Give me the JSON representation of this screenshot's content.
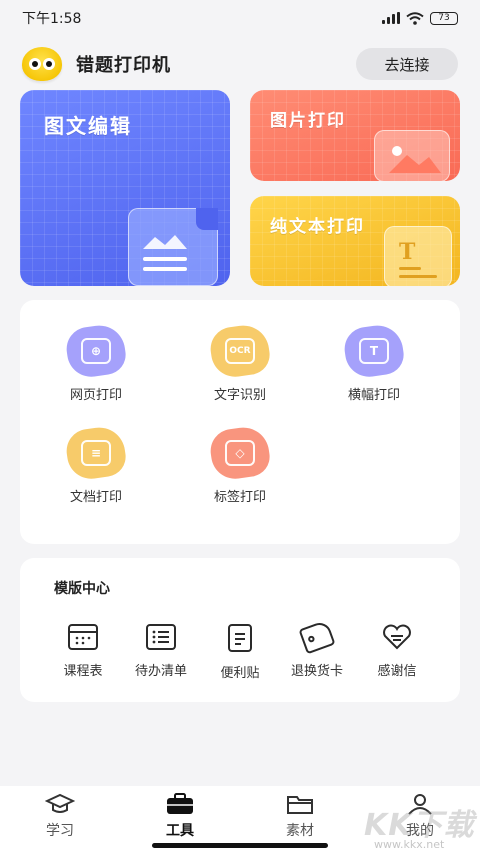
{
  "status_bar": {
    "time": "下午1:58",
    "battery": "73"
  },
  "header": {
    "title": "错题打印机",
    "connect_label": "去连接"
  },
  "feature_cards": {
    "image_text_edit": "图文编辑",
    "image_print": "图片打印",
    "plain_text_print": "纯文本打印"
  },
  "tools": [
    {
      "label": "网页打印",
      "icon": "monitor-icon",
      "color": "#8f8cf7"
    },
    {
      "label": "文字识别",
      "icon": "ocr-icon",
      "color": "#f6c55a"
    },
    {
      "label": "横幅打印",
      "icon": "banner-text-icon",
      "color": "#8f8cf7"
    },
    {
      "label": "文档打印",
      "icon": "document-icon",
      "color": "#f6c55a"
    },
    {
      "label": "标签打印",
      "icon": "tag-icon",
      "color": "#f88a70"
    }
  ],
  "template_center": {
    "heading": "模版中心",
    "items": [
      {
        "label": "课程表",
        "icon": "calendar-icon"
      },
      {
        "label": "待办清单",
        "icon": "checklist-icon"
      },
      {
        "label": "便利贴",
        "icon": "note-icon"
      },
      {
        "label": "退换货卡",
        "icon": "tag-card-icon"
      },
      {
        "label": "感谢信",
        "icon": "heart-letter-icon"
      }
    ]
  },
  "bottom_nav": {
    "items": [
      {
        "label": "学习",
        "icon": "graduation-cap-icon",
        "active": false
      },
      {
        "label": "工具",
        "icon": "toolbox-icon",
        "active": true
      },
      {
        "label": "素材",
        "icon": "folder-icon",
        "active": false
      },
      {
        "label": "我的",
        "icon": "user-icon",
        "active": false
      }
    ]
  },
  "watermark": {
    "text": "KK下载",
    "url": "www.kkx.net"
  }
}
